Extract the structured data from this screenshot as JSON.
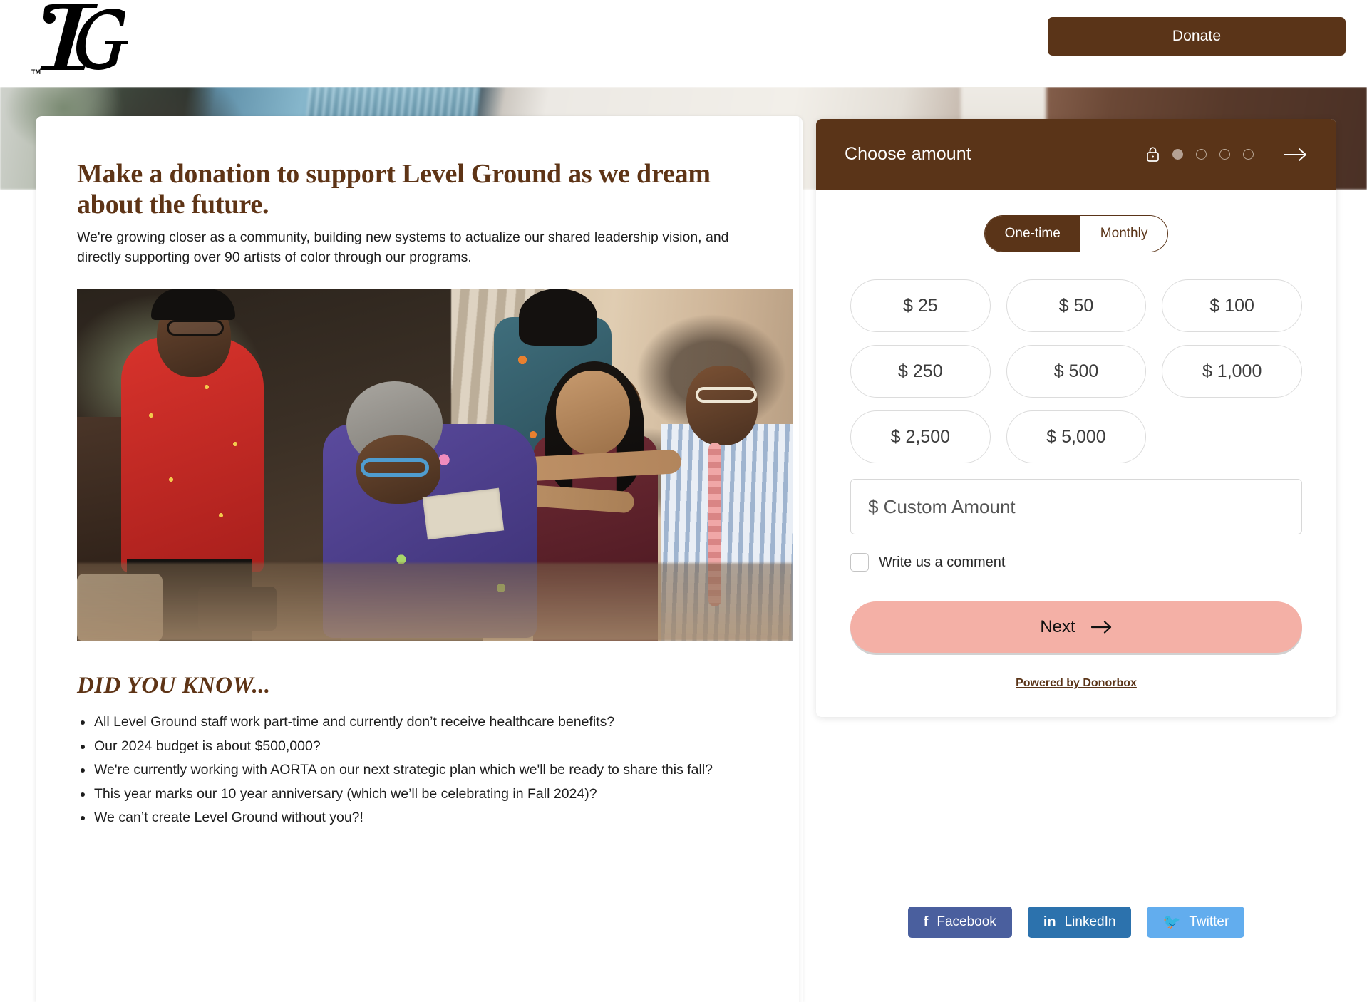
{
  "header": {
    "logo_alt": "Level Ground LG monogram logo",
    "donate_label": "Donate"
  },
  "content": {
    "heading": "Make a donation to support Level Ground as we dream about the future.",
    "intro": "We're growing closer as a community, building new systems to actualize our shared leadership vision, and directly supporting over 90 artists of color through our programs.",
    "photo_alt": "Crowd of people dancing and celebrating at a Level Ground event",
    "did_you_know_heading": "DID YOU KNOW...",
    "facts": [
      "All Level Ground staff work part-time and currently don’t receive healthcare benefits?",
      "Our 2024 budget is about  $500,000?",
      "We're currently working with AORTA on our next strategic plan which we'll be ready to share this fall?",
      "This year marks our 10 year anniversary (which we’ll be celebrating in Fall 2024)?",
      "We can’t create Level Ground without you?!"
    ]
  },
  "donation": {
    "title": "Choose amount",
    "lock_icon": "lock-icon",
    "steps": {
      "total": 4,
      "current": 1
    },
    "next_arrow_icon": "arrow-right-icon",
    "frequency": {
      "options": [
        "One-time",
        "Monthly"
      ],
      "selected": "One-time"
    },
    "amounts": [
      "$ 25",
      "$ 50",
      "$ 100",
      "$ 250",
      "$ 500",
      "$ 1,000",
      "$ 2,500",
      "$ 5,000"
    ],
    "custom_amount": {
      "placeholder": "$ Custom Amount",
      "value": ""
    },
    "comment": {
      "label": "Write us a comment",
      "checked": false
    },
    "next_label": "Next",
    "powered_by": "Powered by Donorbox"
  },
  "social": [
    {
      "label": "Facebook",
      "icon": "facebook-icon",
      "color": "#4A5F9E"
    },
    {
      "label": "LinkedIn",
      "icon": "linkedin-icon",
      "color": "#2C72AD"
    },
    {
      "label": "Twitter",
      "icon": "twitter-icon",
      "color": "#62ADEE"
    }
  ],
  "colors": {
    "brand_brown": "#5A3418",
    "accent_salmon": "#F4B0A6",
    "step_active": "#B5A193"
  }
}
